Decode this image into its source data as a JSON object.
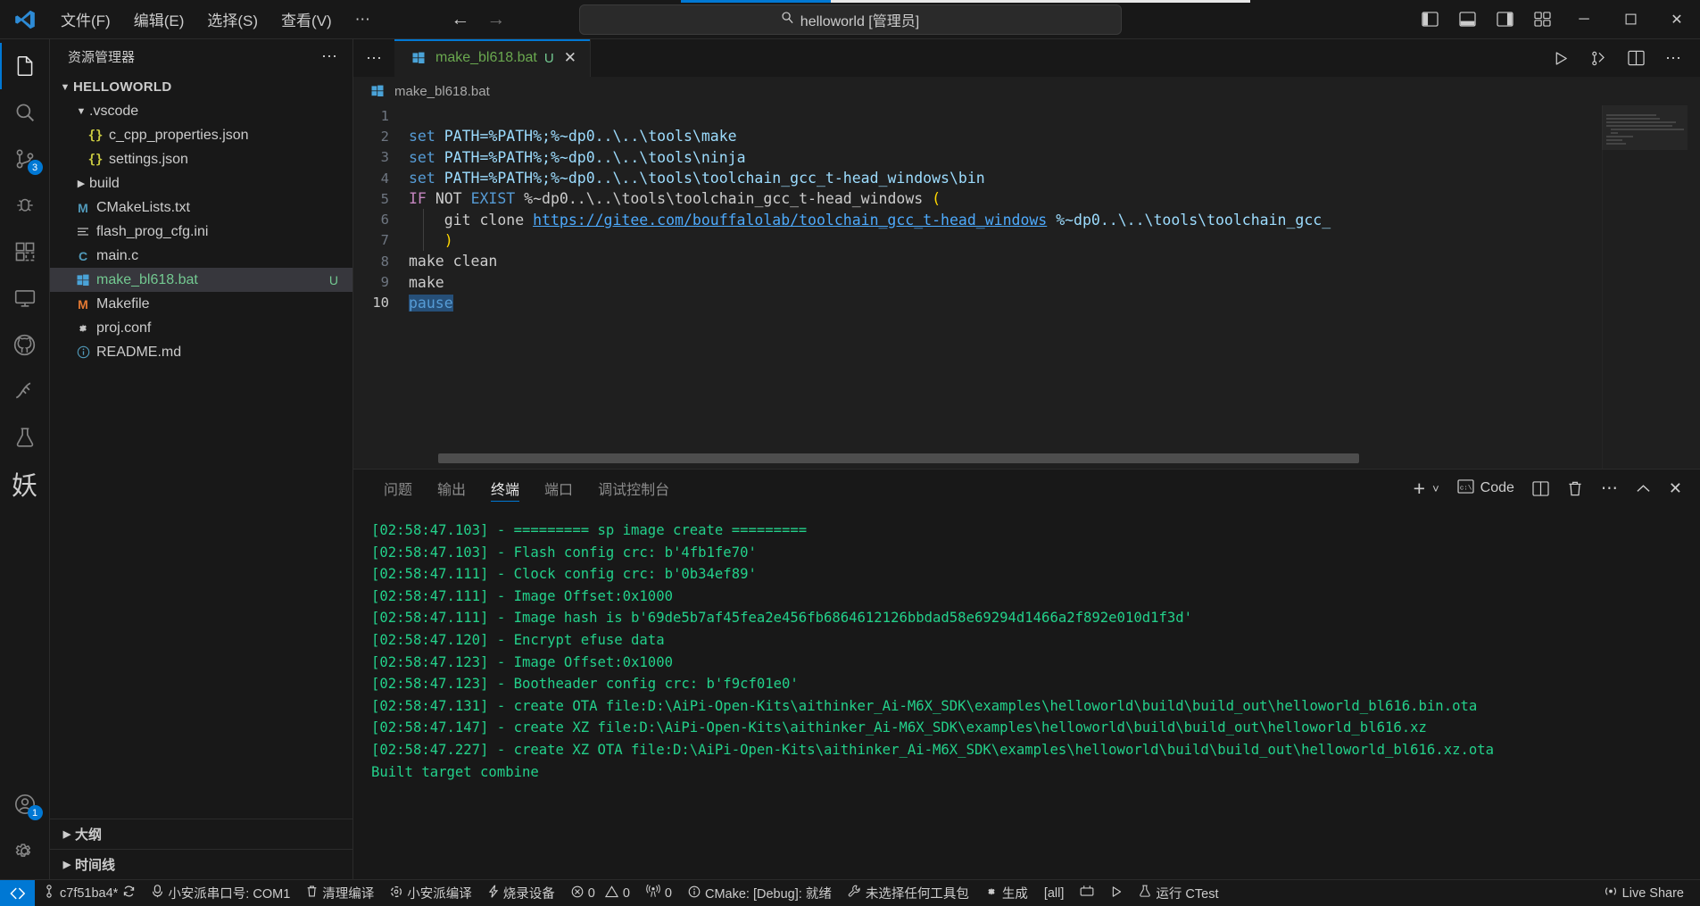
{
  "titlebar": {
    "menus": [
      "文件(F)",
      "编辑(E)",
      "选择(S)",
      "查看(V)",
      "⋯"
    ],
    "nav_back": "←",
    "nav_forward": "→",
    "command_center": {
      "icon": "search-icon",
      "text": "helloworld [管理员]"
    },
    "layout_icons": [
      "toggle-primary-sidebar-icon",
      "toggle-panel-icon",
      "toggle-secondary-sidebar-icon",
      "customize-layout-icon"
    ],
    "window_controls": {
      "minimize": "─",
      "maximize": "☐",
      "close": "✕"
    },
    "accent_color": "#0078d4"
  },
  "activitybar": {
    "items": [
      {
        "name": "explorer",
        "icon": "files-icon",
        "badge": ""
      },
      {
        "name": "search",
        "icon": "search-icon",
        "badge": ""
      },
      {
        "name": "source-control",
        "icon": "source-control-icon",
        "badge": "3"
      },
      {
        "name": "run-and-debug",
        "icon": "debug-icon",
        "badge": ""
      },
      {
        "name": "extensions",
        "icon": "extensions-icon",
        "badge": ""
      },
      {
        "name": "remote-explorer",
        "icon": "remote-icon",
        "badge": ""
      },
      {
        "name": "github",
        "icon": "github-icon",
        "badge": ""
      },
      {
        "name": "serial-monitor",
        "icon": "plug-icon",
        "badge": ""
      },
      {
        "name": "testing",
        "icon": "beaker-icon",
        "badge": ""
      },
      {
        "name": "yao-extension",
        "icon": "yao-glyph",
        "badge": "",
        "label": "妖"
      }
    ],
    "bottom_items": [
      {
        "name": "accounts",
        "icon": "account-icon",
        "badge": "1"
      },
      {
        "name": "manage",
        "icon": "gear-icon",
        "badge": ""
      }
    ]
  },
  "sidebar": {
    "title": "资源管理器",
    "more_actions": "⋯",
    "tree": [
      {
        "label": "HELLOWORLD",
        "kind": "root",
        "expanded": true,
        "indent": 0,
        "icon": "",
        "badge": ""
      },
      {
        "label": ".vscode",
        "kind": "folder",
        "expanded": true,
        "indent": 1,
        "icon": "",
        "badge": ""
      },
      {
        "label": "c_cpp_properties.json",
        "kind": "file",
        "indent": 2,
        "icon": "json-icon",
        "badge": ""
      },
      {
        "label": "settings.json",
        "kind": "file",
        "indent": 2,
        "icon": "json-icon",
        "badge": ""
      },
      {
        "label": "build",
        "kind": "folder",
        "expanded": false,
        "indent": 1,
        "icon": "",
        "badge": ""
      },
      {
        "label": "CMakeLists.txt",
        "kind": "file",
        "indent": 1,
        "icon": "cmake-icon",
        "badge": ""
      },
      {
        "label": "flash_prog_cfg.ini",
        "kind": "file",
        "indent": 1,
        "icon": "ini-icon",
        "badge": ""
      },
      {
        "label": "main.c",
        "kind": "file",
        "indent": 1,
        "icon": "c-icon",
        "badge": ""
      },
      {
        "label": "make_bl618.bat",
        "kind": "file",
        "indent": 1,
        "icon": "windows-icon",
        "badge": "U",
        "selected": true
      },
      {
        "label": "Makefile",
        "kind": "file",
        "indent": 1,
        "icon": "makefile-icon",
        "badge": ""
      },
      {
        "label": "proj.conf",
        "kind": "file",
        "indent": 1,
        "icon": "gear-icon",
        "badge": ""
      },
      {
        "label": "README.md",
        "kind": "file",
        "indent": 1,
        "icon": "info-icon",
        "badge": ""
      }
    ],
    "sections": [
      {
        "label": "大纲",
        "expanded": false
      },
      {
        "label": "时间线",
        "expanded": false
      }
    ]
  },
  "editor": {
    "tab": {
      "label": "make_bl618.bat",
      "badge": "U",
      "close": "✕",
      "icon": "windows-icon"
    },
    "tab_more": "⋯",
    "actions": [
      "run-icon",
      "run-test-icon",
      "split-editor-icon",
      "more-actions-icon"
    ],
    "breadcrumb": {
      "icon": "windows-icon",
      "text": "make_bl618.bat"
    },
    "lines": [
      {
        "n": "1",
        "tokens": []
      },
      {
        "n": "2",
        "tokens": [
          {
            "t": "set ",
            "c": "k-cmd"
          },
          {
            "t": "PATH=%PATH%;%~dp0..\\..\\tools\\make",
            "c": "k-var"
          }
        ]
      },
      {
        "n": "3",
        "tokens": [
          {
            "t": "set ",
            "c": "k-cmd"
          },
          {
            "t": "PATH=%PATH%;%~dp0..\\..\\tools\\ninja",
            "c": "k-var"
          }
        ]
      },
      {
        "n": "4",
        "tokens": [
          {
            "t": "set ",
            "c": "k-cmd"
          },
          {
            "t": "PATH=%PATH%;%~dp0..\\..\\tools\\toolchain_gcc_t-head_windows\\bin",
            "c": "k-var"
          }
        ]
      },
      {
        "n": "5",
        "tokens": [
          {
            "t": "IF ",
            "c": "k-if"
          },
          {
            "t": "NOT ",
            "c": "k-white"
          },
          {
            "t": "EXIST ",
            "c": "k-cmd"
          },
          {
            "t": "%~dp0..\\..\\tools\\toolchain_gcc_t-head_windows ",
            "c": "k-white"
          },
          {
            "t": "(",
            "c": "k-paren"
          }
        ]
      },
      {
        "n": "6",
        "tokens": [
          {
            "t": "    git clone ",
            "c": "k-white"
          },
          {
            "t": "https://gitee.com/bouffalolab/toolchain_gcc_t-head_windows",
            "c": "k-link"
          },
          {
            "t": " ",
            "c": "k-white"
          },
          {
            "t": "%~dp0..\\..\\tools\\toolchain_gcc_",
            "c": "k-var"
          }
        ]
      },
      {
        "n": "7",
        "tokens": [
          {
            "t": "    ",
            "c": "k-white"
          },
          {
            "t": ")",
            "c": "k-paren"
          }
        ]
      },
      {
        "n": "8",
        "tokens": [
          {
            "t": "make clean",
            "c": "k-white"
          }
        ]
      },
      {
        "n": "9",
        "tokens": [
          {
            "t": "make",
            "c": "k-white"
          }
        ]
      },
      {
        "n": "10",
        "tokens": [
          {
            "t": "pause",
            "c": "k-cmd sel-hl"
          }
        ],
        "current": true
      }
    ]
  },
  "panel": {
    "tabs": [
      {
        "label": "问题",
        "active": false
      },
      {
        "label": "输出",
        "active": false
      },
      {
        "label": "终端",
        "active": true
      },
      {
        "label": "端口",
        "active": false
      },
      {
        "label": "调试控制台",
        "active": false
      }
    ],
    "actions": {
      "new_terminal": "+",
      "new_terminal_dropdown": "˅",
      "terminal_name": "Code",
      "terminal_icon": "console-icon",
      "split": "split-terminal-icon",
      "kill": "trash-icon",
      "more": "⋯",
      "maximize": "⌃",
      "close": "✕"
    },
    "terminal_lines": [
      "[02:58:47.103] - ========= sp image create =========",
      "[02:58:47.103] - Flash config crc: b'4fb1fe70'",
      "[02:58:47.111] - Clock config crc: b'0b34ef89'",
      "[02:58:47.111] - Image Offset:0x1000",
      "[02:58:47.111] - Image hash is b'69de5b7af45fea2e456fb6864612126bbdad58e69294d1466a2f892e010d1f3d'",
      "[02:58:47.120] - Encrypt efuse data",
      "[02:58:47.123] - Image Offset:0x1000",
      "[02:58:47.123] - Bootheader config crc: b'f9cf01e0'",
      "[02:58:47.131] - create OTA file:D:\\AiPi-Open-Kits\\aithinker_Ai-M6X_SDK\\examples\\helloworld\\build\\build_out\\helloworld_bl616.bin.ota",
      "[02:58:47.147] - create XZ file:D:\\AiPi-Open-Kits\\aithinker_Ai-M6X_SDK\\examples\\helloworld\\build\\build_out\\helloworld_bl616.xz",
      "[02:58:47.227] - create XZ OTA file:D:\\AiPi-Open-Kits\\aithinker_Ai-M6X_SDK\\examples\\helloworld\\build\\build_out\\helloworld_bl616.xz.ota",
      "Built target combine"
    ],
    "terminal_color": "#23d18b"
  },
  "statusbar": {
    "remote": {
      "icon": "remote-indicator-icon"
    },
    "left_items": [
      {
        "icon": "source-control-icon",
        "label": "c7f51ba4*",
        "extra": "sync-icon"
      },
      {
        "icon": "serial-port-icon",
        "label": "小安派串口号: COM1"
      },
      {
        "icon": "trash-icon",
        "label": "清理编译"
      },
      {
        "icon": "build-icon",
        "label": "小安派编译"
      },
      {
        "icon": "flash-icon",
        "label": "烧录设备"
      },
      {
        "icon": "error-icon",
        "label": "0",
        "icon2": "warning-icon",
        "label2": "0"
      },
      {
        "icon": "radio-tower-icon",
        "label": "0"
      },
      {
        "icon": "info-icon",
        "label": "CMake: [Debug]: 就绪"
      },
      {
        "icon": "tools-icon",
        "label": "未选择任何工具包"
      },
      {
        "icon": "gear-icon",
        "label": "生成"
      },
      {
        "label": "[all]"
      },
      {
        "icon": "target-icon",
        "label": ""
      },
      {
        "icon": "run-icon",
        "label": ""
      },
      {
        "icon": "beaker-icon",
        "label": "运行 CTest"
      }
    ],
    "right_items": [
      {
        "icon": "broadcast-icon",
        "label": "Live Share"
      }
    ],
    "accent_color": "#0078d4"
  }
}
